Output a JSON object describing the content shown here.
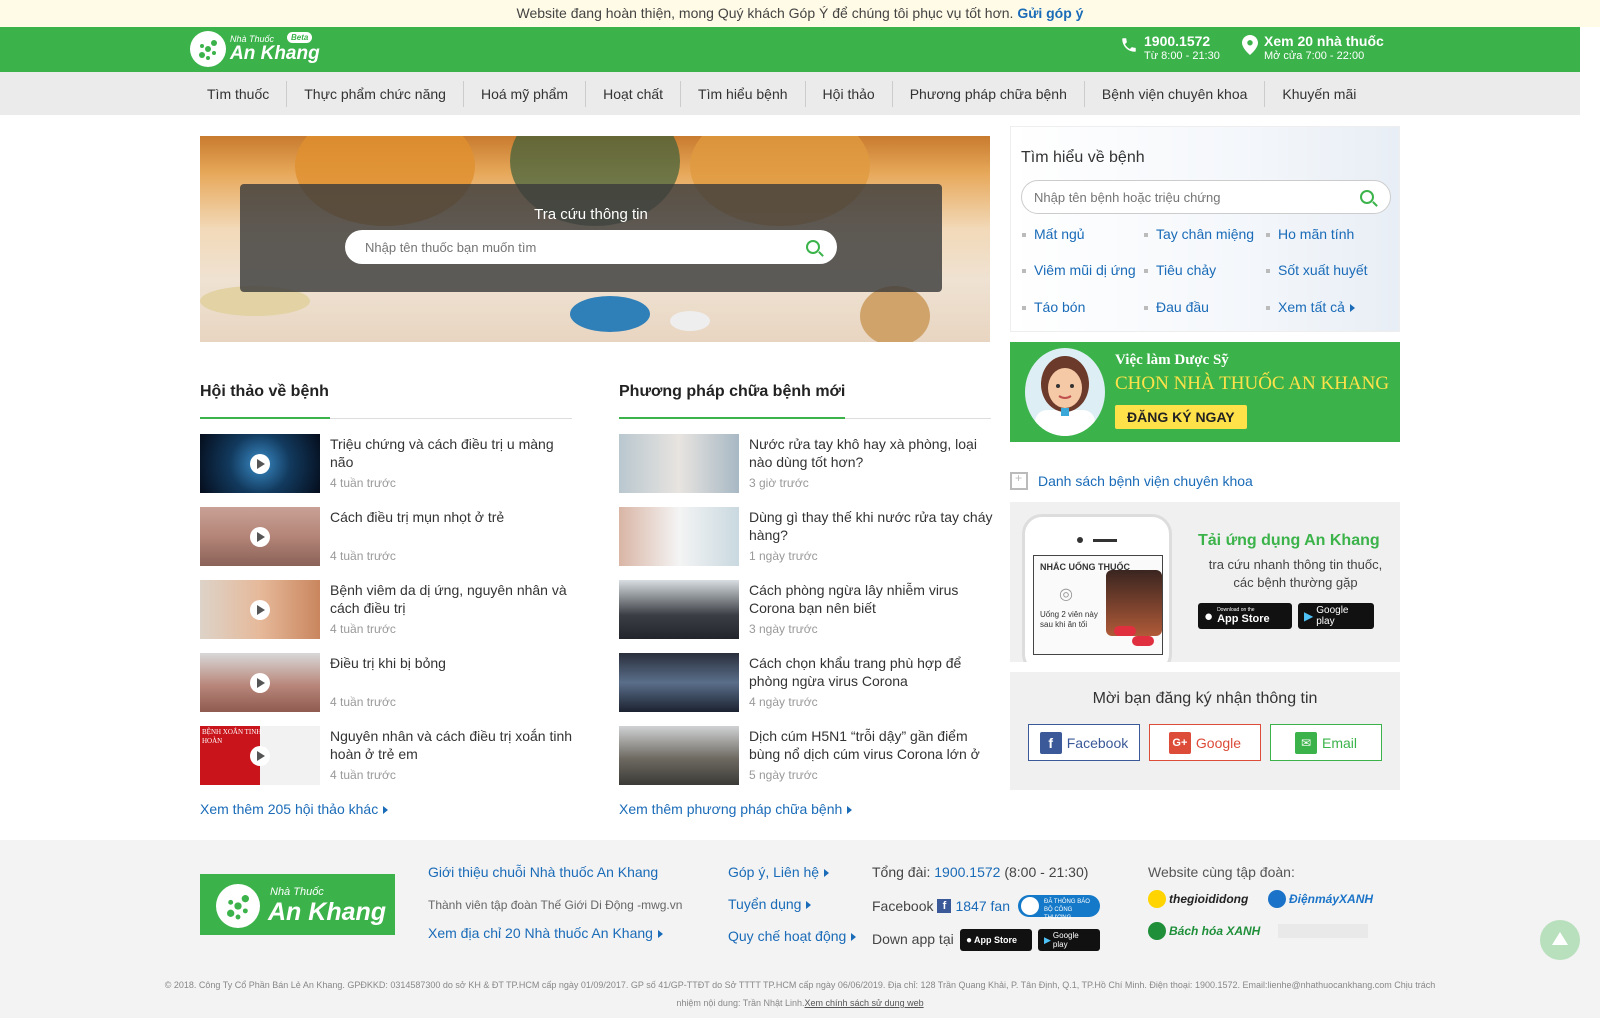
{
  "topbar": {
    "text": "Website đang hoàn thiện, mong Quý khách Góp Ý để chúng tôi phục vụ tốt hơn.",
    "link": "Gửi góp ý"
  },
  "header": {
    "logo_small": "Nhà Thuốc",
    "logo_big": "An Khang",
    "beta": "Beta",
    "phone": "1900.1572",
    "phone_hours": "Từ 8:00 - 21:30",
    "stores": "Xem 20 nhà thuốc",
    "stores_hours": "Mở cửa 7:00 - 22:00"
  },
  "nav": [
    "Tìm thuốc",
    "Thực phẩm chức năng",
    "Hoá mỹ phẩm",
    "Hoạt chất",
    "Tìm hiểu bệnh",
    "Hội thảo",
    "Phương pháp chữa bệnh",
    "Bệnh viện chuyên khoa",
    "Khuyến mãi"
  ],
  "hero": {
    "title": "Tra cứu thông tin",
    "placeholder": "Nhập tên thuốc bạn muốn tìm"
  },
  "seminars": {
    "title": "Hội thảo về bệnh",
    "items": [
      {
        "title": "Triệu chứng và cách điều trị u màng não",
        "time": "4 tuần trước"
      },
      {
        "title": "Cách điều trị mụn nhọt ở trẻ",
        "time": "4 tuần trước"
      },
      {
        "title": "Bệnh viêm da dị ứng, nguyên nhân và cách điều trị",
        "time": "4 tuần trước"
      },
      {
        "title": "Điều trị khi bị bỏng",
        "time": "4 tuần trước"
      },
      {
        "title": "Nguyên nhân và cách điều trị xoắn tinh hoàn ở trẻ em",
        "time": "4 tuần trước"
      }
    ],
    "more": "Xem thêm 205 hội thảo khác",
    "thumb5_text": "BỆNH XOẮN TINH HOÀN"
  },
  "methods": {
    "title": "Phương pháp chữa bệnh mới",
    "items": [
      {
        "title": "Nước rửa tay khô hay xà phòng, loại nào dùng tốt hơn?",
        "time": "3 giờ trước"
      },
      {
        "title": "Dùng gì thay thế khi nước rửa tay cháy hàng?",
        "time": "1 ngày trước"
      },
      {
        "title": "Cách phòng ngừa lây nhiễm virus Corona bạn nên biết",
        "time": "3 ngày trước"
      },
      {
        "title": "Cách chọn khẩu trang phù hợp để phòng ngừa virus Corona",
        "time": "4 ngày trước"
      },
      {
        "title": "Dịch cúm H5N1 “trỗi dậy” gần điểm bùng nổ dịch cúm virus Corona lớn ở",
        "time": "5 ngày trước"
      }
    ],
    "more": "Xem thêm phương pháp chữa bệnh"
  },
  "disease": {
    "title": "Tìm hiểu về bệnh",
    "placeholder": "Nhập tên bệnh hoặc triệu chứng",
    "tags": [
      "Mất ngủ",
      "Tay chân miệng",
      "Ho mãn tính",
      "Viêm mũi dị ứng",
      "Tiêu chảy",
      "Sốt xuất huyết",
      "Táo bón",
      "Đau đầu",
      "Xem tất cả"
    ]
  },
  "banner": {
    "line1": "Việc làm Dược Sỹ",
    "line2": "CHỌN NHÀ THUỐC AN KHANG",
    "button": "ĐĂNG KÝ NGAY"
  },
  "hospital_link": "Danh sách bệnh viện chuyên khoa",
  "app": {
    "title": "Tải ứng dụng An Khang",
    "desc": "tra cứu nhanh thông tin thuốc, các bệnh thường gặp",
    "phone_title": "NHẮC UỐNG THUỐC",
    "phone_text": "Uống 2 viên này sau khi ăn tối",
    "appstore_small": "Download on the",
    "appstore": "App Store",
    "gplay": "Google play"
  },
  "subscribe": {
    "title": "Mời bạn đăng ký nhận thông tin",
    "facebook": "Facebook",
    "google": "Google",
    "email": "Email"
  },
  "footer": {
    "logo_small": "Nhà Thuốc",
    "logo_big": "An Khang",
    "intro": "Giới thiệu chuỗi Nhà thuốc An Khang",
    "member": "Thành viên tập đoàn Thế Giới Di Động -mwg.vn",
    "addresses": "Xem địa chỉ 20 Nhà thuốc An Khang",
    "feedback": "Góp ý, Liên hệ",
    "jobs": "Tuyển dụng",
    "rules": "Quy chế hoạt động",
    "hotline_label": "Tổng đài:",
    "hotline": "1900.1572",
    "hotline_hours": "(8:00 - 21:30)",
    "facebook_label": "Facebook",
    "fans": "1847 fan",
    "registered": "ĐÃ THÔNG BÁO BỘ CÔNG THƯƠNG",
    "download_label": "Down app tại",
    "group_label": "Website cùng tập đoàn:",
    "brands": [
      "thegioididong",
      "ĐiệnmáyXANH",
      "Bách hóa XANH"
    ],
    "copyright": "© 2018. Công Ty Cổ Phần Bán Lẻ An Khang. GPĐKKD: 0314587300 do sở KH & ĐT TP.HCM cấp ngày 01/09/2017. GP số 41/GP-TTĐT do Sở TTTT TP.HCM cấp ngày 06/06/2019. Địa chỉ: 128 Trần Quang Khải, P. Tân Định, Q.1, TP.Hồ Chí Minh. Điện thoại: 1900.1572. Email:lienhe@nhathuocankhang.com Chịu trách",
    "copyright2": "nhiệm nội dung: Trần Nhật Linh.",
    "policy": "Xem chính sách sử dụng web"
  }
}
